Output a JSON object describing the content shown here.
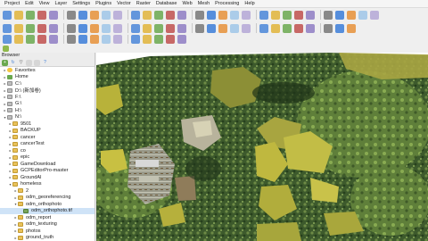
{
  "menu": [
    "Project",
    "Edit",
    "View",
    "Layer",
    "Settings",
    "Plugins",
    "Vector",
    "Raster",
    "Database",
    "Web",
    "Mesh",
    "Processing",
    "Help"
  ],
  "toolbar_icons": [
    "new-project-icon",
    "open-project-icon",
    "save-project-icon",
    "save-as-icon",
    "print-layout-icon",
    "layout-manager-icon",
    "pan-icon",
    "pan-to-selection-icon",
    "zoom-in-icon",
    "zoom-out-icon",
    "zoom-full-icon",
    "zoom-layer-icon",
    "zoom-selection-icon",
    "zoom-last-icon",
    "zoom-next-icon",
    "new-map-view-icon",
    "temporal-icon",
    "refresh-icon",
    "identify-icon",
    "select-feature-icon",
    "deselect-icon",
    "attribute-table-icon",
    "field-calculator-icon",
    "statistics-icon",
    "toolbox-icon",
    "map-tips-icon",
    "measure-icon",
    "annotation-icon",
    "plugin-a-icon",
    "plugin-b-icon"
  ],
  "browser": {
    "title": "Browser",
    "tree": [
      {
        "label": "Favorites",
        "indent": 0,
        "icon": "fav",
        "arrow": "▸"
      },
      {
        "label": "Home",
        "indent": 0,
        "icon": "home",
        "arrow": "▸"
      },
      {
        "label": "C:\\",
        "indent": 0,
        "icon": "drive",
        "arrow": "▸"
      },
      {
        "label": "D:\\ (新加卷)",
        "indent": 0,
        "icon": "drive",
        "arrow": "▸"
      },
      {
        "label": "F:\\",
        "indent": 0,
        "icon": "drive",
        "arrow": "▸"
      },
      {
        "label": "G:\\",
        "indent": 0,
        "icon": "drive",
        "arrow": "▸"
      },
      {
        "label": "H:\\",
        "indent": 0,
        "icon": "drive",
        "arrow": "▸"
      },
      {
        "label": "N:\\",
        "indent": 0,
        "icon": "drive",
        "arrow": "▾"
      },
      {
        "label": "9501",
        "indent": 1,
        "icon": "folder",
        "arrow": "▸"
      },
      {
        "label": "BACKUP",
        "indent": 1,
        "icon": "folder",
        "arrow": "▸"
      },
      {
        "label": "cancer",
        "indent": 1,
        "icon": "folder",
        "arrow": "▸"
      },
      {
        "label": "cancerTest",
        "indent": 1,
        "icon": "folder",
        "arrow": "▸"
      },
      {
        "label": "co",
        "indent": 1,
        "icon": "folder",
        "arrow": "▸"
      },
      {
        "label": "epic",
        "indent": 1,
        "icon": "folder",
        "arrow": "▸"
      },
      {
        "label": "GameDownload",
        "indent": 1,
        "icon": "folder",
        "arrow": "▸"
      },
      {
        "label": "GCPEditorPro-master",
        "indent": 1,
        "icon": "folder",
        "arrow": "▸"
      },
      {
        "label": "GroundAI",
        "indent": 1,
        "icon": "folder",
        "arrow": "▸"
      },
      {
        "label": "homeless",
        "indent": 1,
        "icon": "folder",
        "arrow": "▾"
      },
      {
        "label": "2",
        "indent": 2,
        "icon": "folder",
        "arrow": "▸"
      },
      {
        "label": "odm_georeferencing",
        "indent": 2,
        "icon": "folder",
        "arrow": "▸"
      },
      {
        "label": "odm_orthophoto",
        "indent": 2,
        "icon": "folder",
        "arrow": "▾"
      },
      {
        "label": "odm_orthophoto.tif",
        "indent": 3,
        "icon": "raster",
        "arrow": ""
      },
      {
        "label": "odm_report",
        "indent": 2,
        "icon": "folder",
        "arrow": "▸"
      },
      {
        "label": "odm_texturing",
        "indent": 2,
        "icon": "folder",
        "arrow": "▸"
      },
      {
        "label": "photos",
        "indent": 2,
        "icon": "folder",
        "arrow": "▸"
      },
      {
        "label": "ground_truth",
        "indent": 2,
        "icon": "folder",
        "arrow": "▸"
      }
    ],
    "selected_index": 21
  },
  "colors": {
    "accent": "#3b7dd8",
    "vegetation_dark": "#3f5a2a",
    "vegetation_light": "#9bbd5a",
    "highlight_yellow": "#c9c24a"
  }
}
